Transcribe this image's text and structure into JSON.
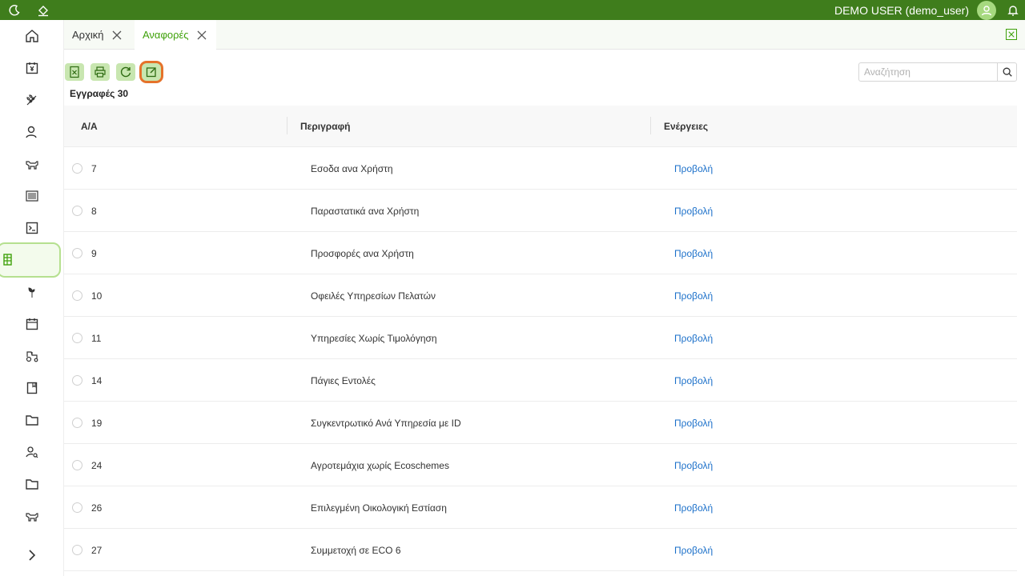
{
  "topbar": {
    "user_name": "DEMO USER (demo_user)",
    "icons": [
      "moon-icon",
      "paint-bucket-icon",
      "avatar-icon",
      "bell-icon"
    ]
  },
  "sidebar": {
    "items": [
      {
        "icon": "home-icon"
      },
      {
        "icon": "yen-calendar-icon"
      },
      {
        "icon": "wheat-icon"
      },
      {
        "icon": "user-icon"
      },
      {
        "icon": "cow-icon"
      },
      {
        "icon": "barcode-icon"
      },
      {
        "icon": "terminal-icon"
      },
      {
        "icon": "table-icon",
        "active": true
      },
      {
        "icon": "sprout-icon"
      },
      {
        "icon": "calendar-icon"
      },
      {
        "icon": "tractor-icon"
      },
      {
        "icon": "book-icon"
      },
      {
        "icon": "folder-icon"
      },
      {
        "icon": "user-search-icon"
      },
      {
        "icon": "folder-icon"
      },
      {
        "icon": "cow-icon"
      },
      {
        "icon": "chevron-right-icon"
      }
    ]
  },
  "tabs": [
    {
      "label": "Αρχική",
      "active": false
    },
    {
      "label": "Αναφορές",
      "active": true
    }
  ],
  "toolbar": {
    "buttons": [
      "excel-export-icon",
      "print-icon",
      "refresh-icon",
      "edit-icon"
    ],
    "records_label": "Εγγραφές 30"
  },
  "search": {
    "placeholder": "Αναζήτηση"
  },
  "table": {
    "headers": {
      "id": "Α/Α",
      "description": "Περιγραφή",
      "actions": "Ενέργειες"
    },
    "rows": [
      {
        "id": "7",
        "description": "Εσοδα ανα Χρήστη",
        "action": "Προβολή"
      },
      {
        "id": "8",
        "description": "Παραστατικά ανα Χρήστη",
        "action": "Προβολή"
      },
      {
        "id": "9",
        "description": "Προσφορές ανα Χρήστη",
        "action": "Προβολή"
      },
      {
        "id": "10",
        "description": "Οφειλές Υπηρεσίων Πελατών",
        "action": "Προβολή"
      },
      {
        "id": "11",
        "description": "Υπηρεσίες Χωρίς Τιμολόγηση",
        "action": "Προβολή"
      },
      {
        "id": "14",
        "description": "Πάγιες Εντολές",
        "action": "Προβολή"
      },
      {
        "id": "19",
        "description": "Συγκεντρωτικό Ανά Υπηρεσία με ID",
        "action": "Προβολή"
      },
      {
        "id": "24",
        "description": "Αγροτεμάχια χωρίς Ecoschemes",
        "action": "Προβολή"
      },
      {
        "id": "26",
        "description": "Επιλεγμένη Οικολογική Εστίαση",
        "action": "Προβολή"
      },
      {
        "id": "27",
        "description": "Συμμετοχή σε ECO 6",
        "action": "Προβολή"
      }
    ]
  },
  "colors": {
    "topbar": "#3f7d1c",
    "accent_green": "#3fa10a",
    "link_blue": "#1a6fc9",
    "highlight_orange": "#e5722a"
  }
}
